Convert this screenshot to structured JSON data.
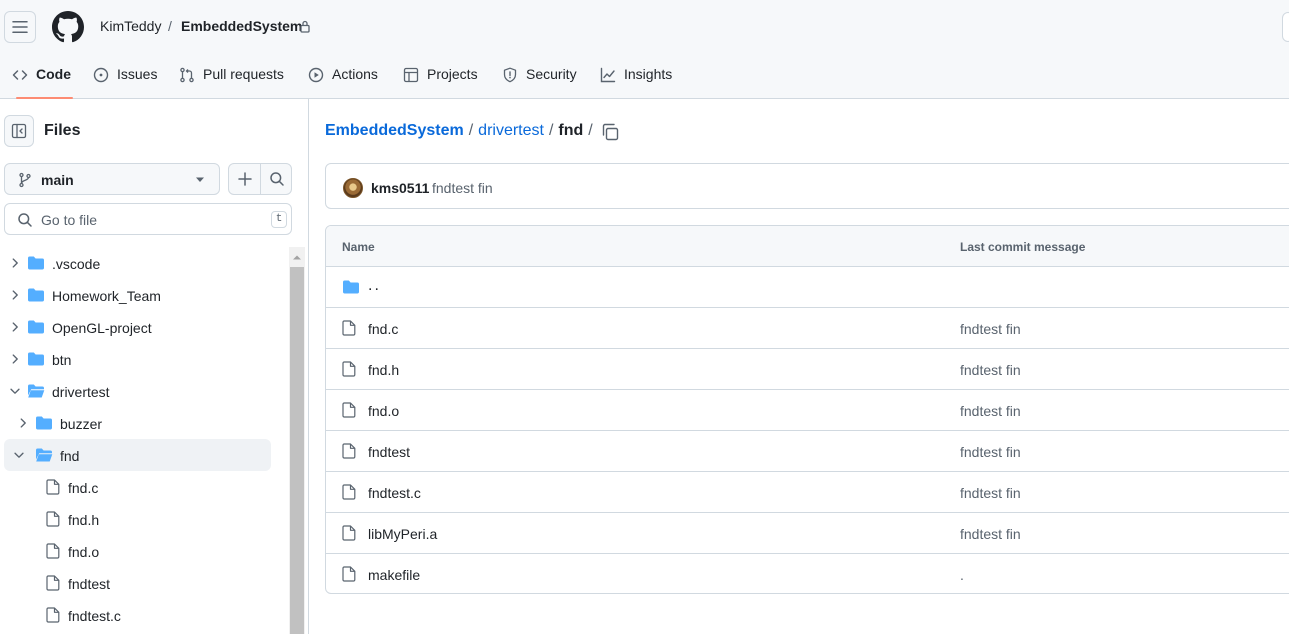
{
  "header": {
    "owner": "KimTeddy",
    "separator": "/",
    "repo": "EmbeddedSystem",
    "icons": {
      "menu": "hamburger-icon",
      "logo": "github-mark-icon",
      "lock": "lock-icon"
    }
  },
  "tabs": [
    {
      "label": "Code",
      "icon": "code-icon",
      "active": true
    },
    {
      "label": "Issues",
      "icon": "issue-opened-icon"
    },
    {
      "label": "Pull requests",
      "icon": "git-pull-request-icon"
    },
    {
      "label": "Actions",
      "icon": "play-icon"
    },
    {
      "label": "Projects",
      "icon": "table-icon"
    },
    {
      "label": "Security",
      "icon": "shield-icon"
    },
    {
      "label": "Insights",
      "icon": "graph-icon"
    }
  ],
  "sidebar": {
    "title": "Files",
    "branch": "main",
    "search_placeholder": "Go to file",
    "search_shortcut": "t",
    "tree": [
      {
        "label": ".vscode",
        "type": "folder",
        "expanded": false,
        "depth": 0
      },
      {
        "label": "Homework_Team",
        "type": "folder",
        "expanded": false,
        "depth": 0
      },
      {
        "label": "OpenGL-project",
        "type": "folder",
        "expanded": false,
        "depth": 0
      },
      {
        "label": "btn",
        "type": "folder",
        "expanded": false,
        "depth": 0
      },
      {
        "label": "drivertest",
        "type": "folder",
        "expanded": true,
        "depth": 0
      },
      {
        "label": "buzzer",
        "type": "folder",
        "expanded": false,
        "depth": 1
      },
      {
        "label": "fnd",
        "type": "folder",
        "expanded": true,
        "depth": 1,
        "selected": true
      },
      {
        "label": "fnd.c",
        "type": "file",
        "depth": 2
      },
      {
        "label": "fnd.h",
        "type": "file",
        "depth": 2
      },
      {
        "label": "fnd.o",
        "type": "file",
        "depth": 2
      },
      {
        "label": "fndtest",
        "type": "file",
        "depth": 2
      },
      {
        "label": "fndtest.c",
        "type": "file",
        "depth": 2
      }
    ]
  },
  "breadcrumb": {
    "repo": "EmbeddedSystem",
    "dir": "drivertest",
    "current": "fnd",
    "sep": "/"
  },
  "latest_commit": {
    "author": "kms0511",
    "message": "fndtest fin"
  },
  "table": {
    "col_name": "Name",
    "col_message": "Last commit message",
    "parent_link": "..",
    "rows": [
      {
        "name": "fnd.c",
        "message": "fndtest fin"
      },
      {
        "name": "fnd.h",
        "message": "fndtest fin"
      },
      {
        "name": "fnd.o",
        "message": "fndtest fin"
      },
      {
        "name": "fndtest",
        "message": "fndtest fin"
      },
      {
        "name": "fndtest.c",
        "message": "fndtest fin"
      },
      {
        "name": "libMyPeri.a",
        "message": "fndtest fin"
      },
      {
        "name": "makefile",
        "message": "."
      }
    ]
  },
  "colors": {
    "link": "#0969da",
    "tab_underline": "#fd8c73",
    "folder": "#54aeff",
    "border": "#d1d9e0",
    "muted_text": "#59636e"
  }
}
